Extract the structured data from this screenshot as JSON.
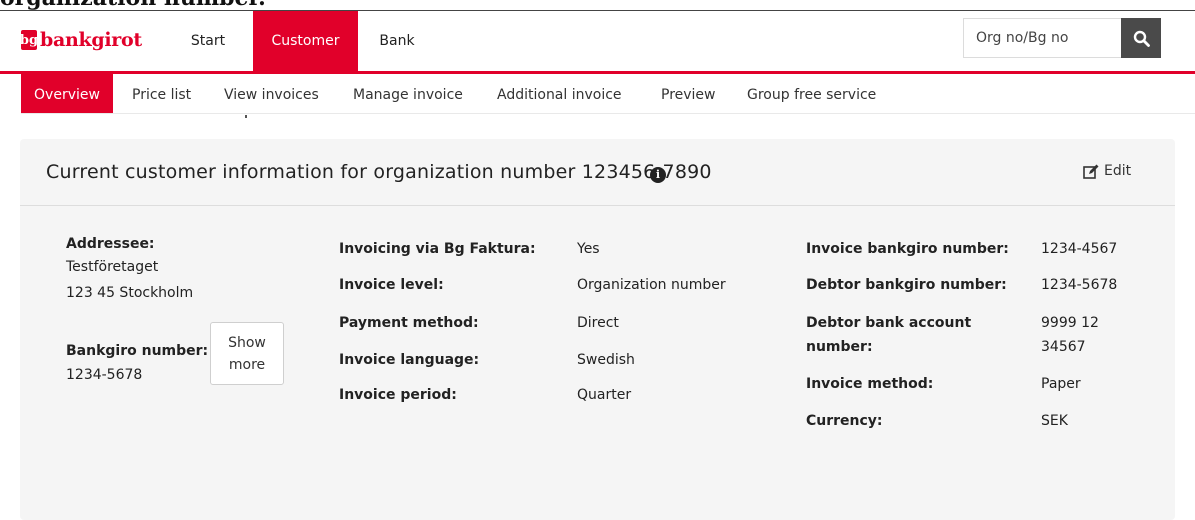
{
  "top_heading": "organization number.",
  "nav": {
    "logo_text": "bankgirot",
    "logo_mark": "bg",
    "items": [
      {
        "label": "Start",
        "active": false
      },
      {
        "label": "Customer",
        "active": true
      },
      {
        "label": "Bank",
        "active": false
      }
    ],
    "search_placeholder": "Org no/Bg no",
    "search_icon": "search-icon"
  },
  "subnav": {
    "items": [
      {
        "label": "Overview",
        "active": true
      },
      {
        "label": "Price list",
        "active": false
      },
      {
        "label": "View invoices",
        "active": false
      },
      {
        "label": "Manage invoice",
        "active": false
      },
      {
        "label": "Additional invoice",
        "active": false
      },
      {
        "label": "Preview",
        "active": false
      },
      {
        "label": "Group free service",
        "active": false
      }
    ]
  },
  "panel": {
    "title": "Current customer information for organization number 123456-7890",
    "info_icon": "info-icon",
    "edit_label": "Edit",
    "edit_icon": "edit-icon"
  },
  "addressee": {
    "label": "Addressee:",
    "line1": "Testföretaget",
    "line2": "123 45 Stockholm"
  },
  "bankgiro": {
    "label": "Bankgiro number:",
    "value": "1234-5678",
    "show_more_line1": "Show",
    "show_more_line2": "more"
  },
  "middle": {
    "invoicing_label": "Invoicing via Bg Faktura:",
    "invoicing_value": "Yes",
    "level_label": "Invoice level:",
    "level_value": "Organization number",
    "payment_label": "Payment method:",
    "payment_value": "Direct",
    "language_label": "Invoice language:",
    "language_value": "Swedish",
    "period_label": "Invoice period:",
    "period_value": "Quarter"
  },
  "right": {
    "inv_bg_label": "Invoice bankgiro number:",
    "inv_bg_value": "1234-4567",
    "debtor_bg_label": "Debtor bankgiro number:",
    "debtor_bg_value": "1234-5678",
    "debtor_acct_label1": "Debtor bank account",
    "debtor_acct_label2": "number:",
    "debtor_acct_value1": "9999 12",
    "debtor_acct_value2": "34567",
    "method_label": "Invoice method:",
    "method_value": "Paper",
    "currency_label": "Currency:",
    "currency_value": "SEK"
  },
  "colors": {
    "brand": "#e1002a",
    "search_button": "#4a4a4a",
    "panel_bg": "#f5f5f5"
  }
}
